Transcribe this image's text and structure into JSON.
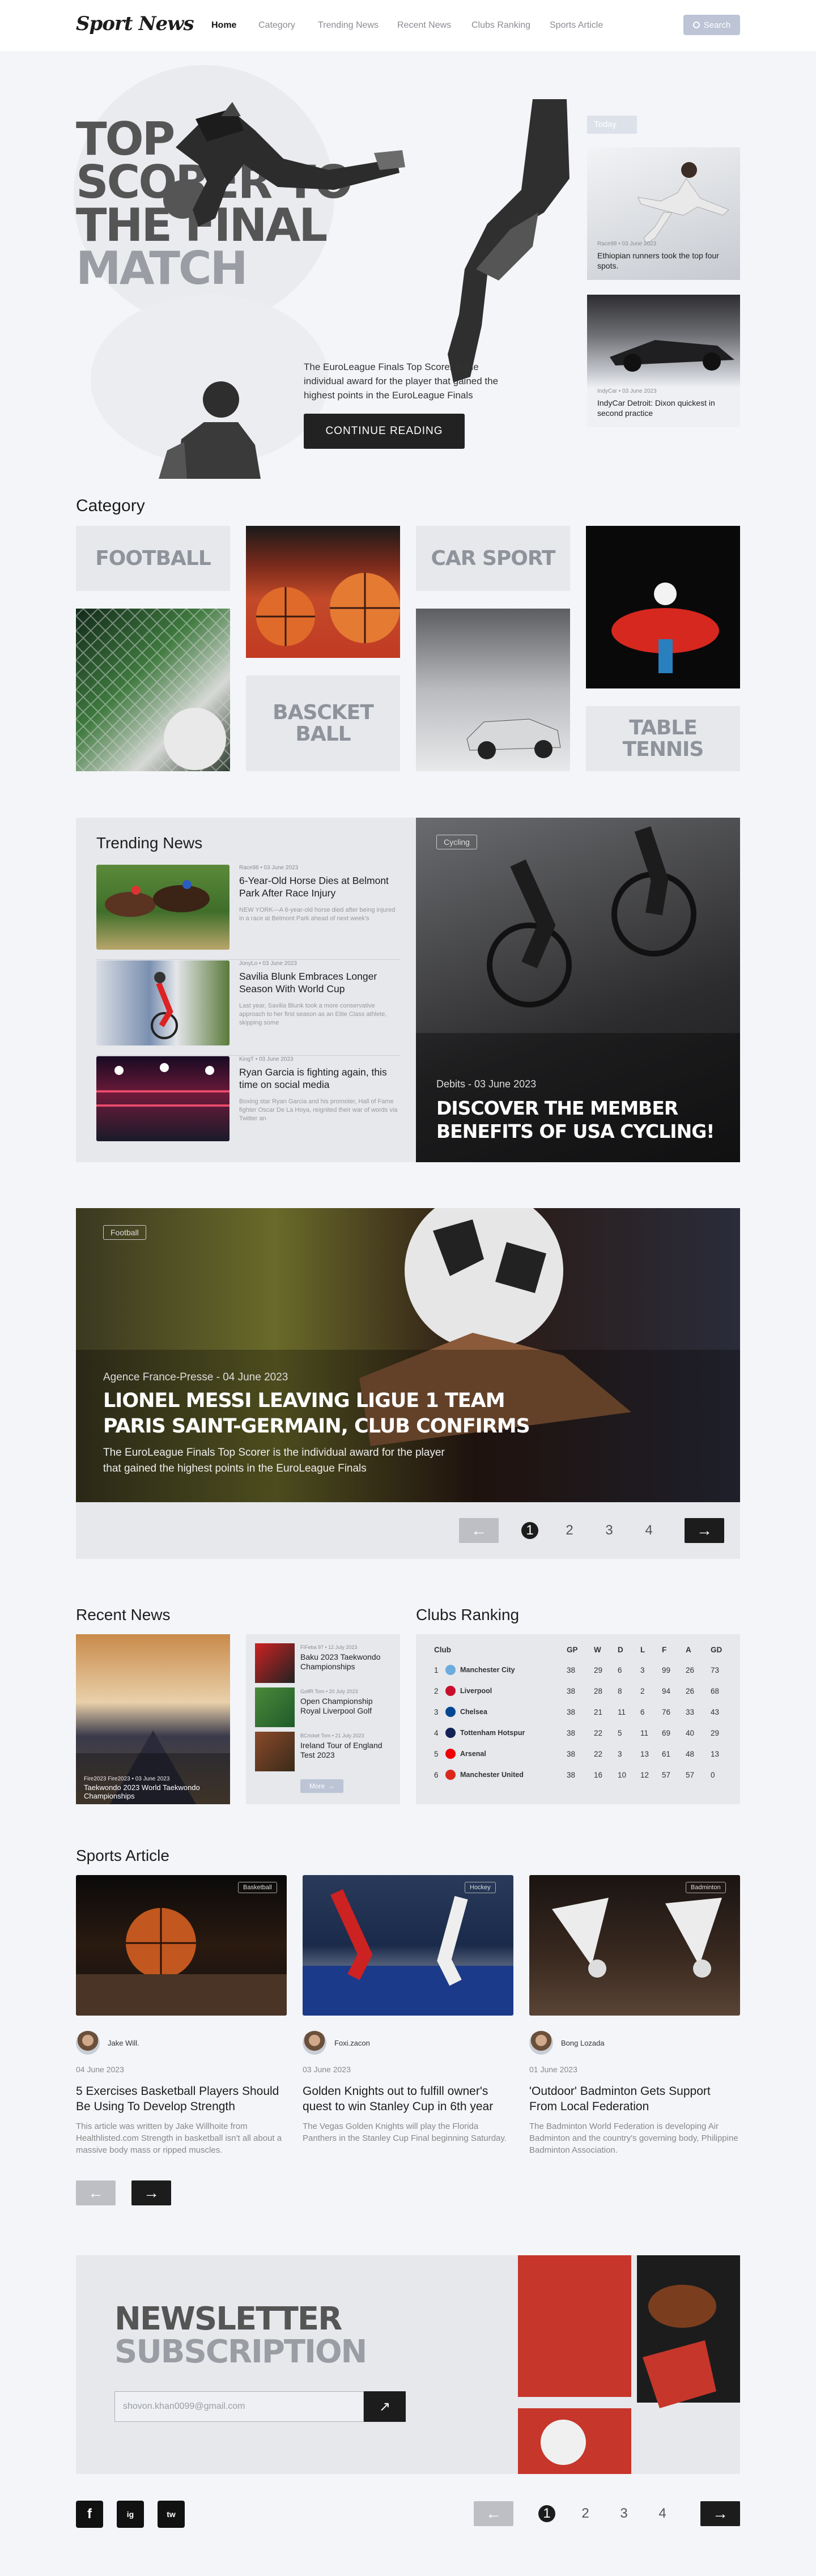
{
  "header": {
    "logo": "Sport News",
    "nav": [
      "Home",
      "Category",
      "Trending News",
      "Recent News",
      "Clubs Ranking",
      "Sports Article"
    ],
    "search_label": "Search"
  },
  "hero": {
    "title_lines": [
      "TOP",
      "SCORER TO",
      "THE FINAL",
      "MATCH"
    ],
    "description": "The EuroLeague Finals Top Scorer is the individual award for the player that gained the highest points in the EuroLeague Finals",
    "cta": "CONTINUE READING",
    "today_label": "Today",
    "cards": [
      {
        "meta": "Race98 • 03 June 2023",
        "title": "Ethiopian runners took the top four spots."
      },
      {
        "meta": "IndyCar • 03 June 2023",
        "title": "IndyCar Detroit: Dixon quickest in second practice"
      }
    ]
  },
  "category": {
    "title": "Category",
    "tiles": [
      "FOOTBALL",
      "CAR SPORT",
      "BASCKET BALL",
      "TABLE TENNIS"
    ]
  },
  "trending": {
    "title": "Trending News",
    "items": [
      {
        "meta": "Race98 • 03 June 2023",
        "title": "6-Year-Old Horse Dies at Belmont Park After Race Injury",
        "desc": "NEW YORK—A 6-year-old horse died after being injured in a race at Belmont Park ahead of next week's"
      },
      {
        "meta": "JonyLo • 03 June 2023",
        "title": "Savilia Blunk Embraces Longer Season With World Cup",
        "desc": "Last year, Savilia Blunk took a more conservative approach to her first season as an Elite Class athlete, skipping some"
      },
      {
        "meta": "KingT • 03 June 2023",
        "title": "Ryan Garcia is fighting again, this time on social media",
        "desc": "Boxing star Ryan Garcia and his promoter, Hall of Fame fighter Oscar De La Hoya, reignited their war of words via Twitter an"
      }
    ],
    "feature": {
      "badge": "Cycling",
      "meta": "Debits - 03 June 2023",
      "title": "DISCOVER THE MEMBER BENEFITS OF USA CYCLING!"
    }
  },
  "banner": {
    "badge": "Football",
    "meta": "Agence France-Presse - 04 June 2023",
    "title_lines": [
      "LIONEL MESSI LEAVING LIGUE 1 TEAM",
      "PARIS SAINT-GERMAIN, CLUB CONFIRMS"
    ],
    "desc_lines": [
      "The EuroLeague Finals Top Scorer is the individual award for the player",
      "that gained the highest points in the EuroLeague Finals"
    ],
    "pages": [
      "1",
      "2",
      "3",
      "4"
    ]
  },
  "recent": {
    "title": "Recent News",
    "main_caption_lines": [
      "Fire2023 Fire2023 • 03 June 2023",
      "Taekwondo 2023 World Taekwondo",
      "Championships"
    ],
    "items": [
      {
        "meta": "FIFeba 97 • 12 July 2023",
        "title": "Baku 2023 Taekwondo Championships"
      },
      {
        "meta": "GolfR Tom • 20 July 2023",
        "title": "Open Championship Royal Liverpool Golf"
      },
      {
        "meta": "BCricket Tom • 21 July 2023",
        "title": "Ireland Tour of England Test 2023"
      }
    ],
    "more_label": "More"
  },
  "clubs": {
    "title": "Clubs Ranking",
    "headers": [
      "Club",
      "GP",
      "W",
      "D",
      "L",
      "F",
      "A",
      "GD"
    ],
    "rows": [
      {
        "rank": "1",
        "club": "Manchester City",
        "gp": "38",
        "w": "29",
        "d": "6",
        "l": "3",
        "f": "99",
        "a": "26",
        "gd": "73",
        "color": "#6cabdd"
      },
      {
        "rank": "2",
        "club": "Liverpool",
        "gp": "38",
        "w": "28",
        "d": "8",
        "l": "2",
        "f": "94",
        "a": "26",
        "gd": "68",
        "color": "#c8102e"
      },
      {
        "rank": "3",
        "club": "Chelsea",
        "gp": "38",
        "w": "21",
        "d": "11",
        "l": "6",
        "f": "76",
        "a": "33",
        "gd": "43",
        "color": "#034694"
      },
      {
        "rank": "4",
        "club": "Tottenham Hotspur",
        "gp": "38",
        "w": "22",
        "d": "5",
        "l": "11",
        "f": "69",
        "a": "40",
        "gd": "29",
        "color": "#132257"
      },
      {
        "rank": "5",
        "club": "Arsenal",
        "gp": "38",
        "w": "22",
        "d": "3",
        "l": "13",
        "f": "61",
        "a": "48",
        "gd": "13",
        "color": "#ef0107"
      },
      {
        "rank": "6",
        "club": "Manchester United",
        "gp": "38",
        "w": "16",
        "d": "10",
        "l": "12",
        "f": "57",
        "a": "57",
        "gd": "0",
        "color": "#da291c"
      }
    ]
  },
  "articles": {
    "title": "Sports Article",
    "items": [
      {
        "badge": "Basketball",
        "author": "Jake Will.",
        "date": "04 June 2023",
        "title": "5 Exercises Basketball Players Should Be Using To Develop Strength",
        "desc": "This article was written by Jake Willhoite from Healthlisted.com Strength in basketball isn't all about a massive body mass or ripped muscles."
      },
      {
        "badge": "Hockey",
        "author": "Foxi.zacon",
        "date": "03 June 2023",
        "title": "Golden Knights out to fulfill owner's quest to win Stanley Cup in 6th year",
        "desc": "The Vegas Golden Knights will play the Florida Panthers in the Stanley Cup Final beginning Saturday."
      },
      {
        "badge": "Badminton",
        "author": "Bong Lozada",
        "date": "01 June 2023",
        "title": "'Outdoor' Badminton Gets Support From Local Federation",
        "desc": "The Badminton World Federation is developing Air Badminton and the country's governing body, Philippine Badminton Association."
      }
    ]
  },
  "newsletter": {
    "title_lines": [
      "NEWSLETTER",
      "SUBSCRIPTION"
    ],
    "email_value": "shovon.khan0099@gmail.com"
  },
  "footer": {
    "social": [
      "f",
      "ig",
      "tw"
    ],
    "pages": [
      "1",
      "2",
      "3",
      "4"
    ]
  }
}
